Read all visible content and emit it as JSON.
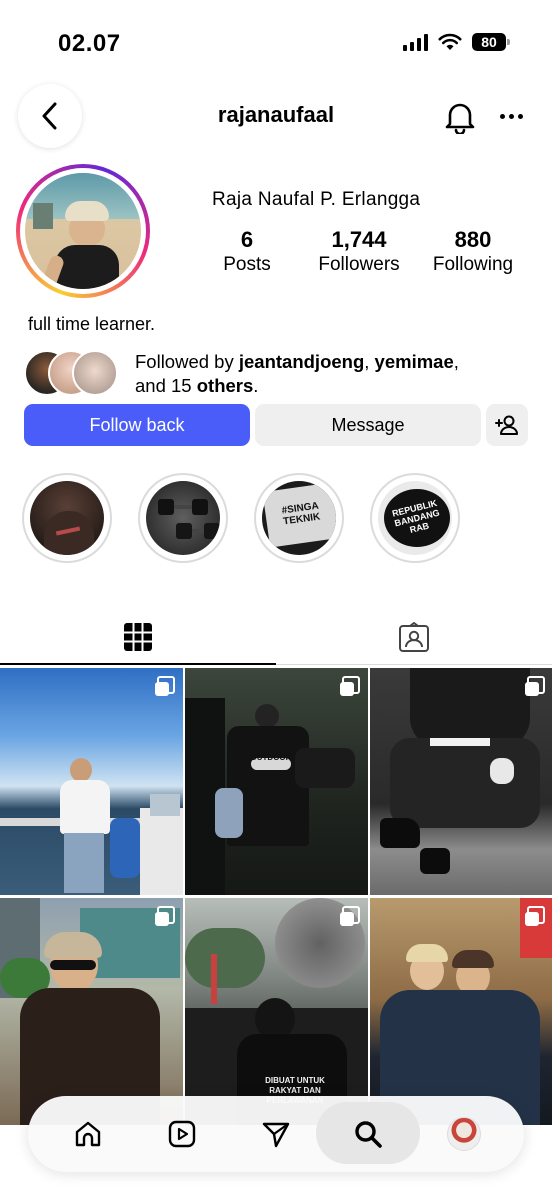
{
  "status_bar": {
    "time": "02.07",
    "battery": "80"
  },
  "header": {
    "username": "rajanaufaal"
  },
  "profile": {
    "full_name": "Raja Naufal P. Erlangga",
    "stats": [
      {
        "value": "6",
        "label": "Posts"
      },
      {
        "value": "1,744",
        "label": "Followers"
      },
      {
        "value": "880",
        "label": "Following"
      }
    ],
    "bio": "full time learner.",
    "followed_by": {
      "prefix": "Followed by ",
      "user1": "jeantandjoeng",
      "sep": ", ",
      "user2": "yemimae",
      "middle": ",",
      "and": "and 15 ",
      "others": "others",
      "end": "."
    }
  },
  "actions": {
    "follow_back": "Follow back",
    "message": "Message"
  },
  "highlights": [
    {
      "icon": "hoodie-photo"
    },
    {
      "icon": "dumbbell-photo"
    },
    {
      "icon": "shirt-print-photo",
      "text": "#SINGA TEKNIK"
    },
    {
      "icon": "sticker-photo",
      "text": "REPUBLIK BANDANG RAB"
    }
  ],
  "tabs": [
    {
      "icon": "grid-icon"
    },
    {
      "icon": "tagged-icon"
    }
  ],
  "posts": [
    {
      "type": "carousel",
      "scene": "boat-sea-sky"
    },
    {
      "type": "carousel",
      "scene": "crowd-outdoor-shirt",
      "text": "OUTDOOR"
    },
    {
      "type": "carousel",
      "scene": "bw-sitting-stairs"
    },
    {
      "type": "carousel",
      "scene": "street-sunglasses"
    },
    {
      "type": "carousel",
      "scene": "protest-smoke-banner",
      "text": "DIBUAT UNTUK RAKYAT DAN PERLAWANAN"
    },
    {
      "type": "carousel",
      "scene": "two-friends-couch"
    }
  ],
  "bottom_nav": [
    {
      "icon": "home-icon"
    },
    {
      "icon": "reels-icon"
    },
    {
      "icon": "send-icon"
    },
    {
      "icon": "search-icon",
      "active": true
    },
    {
      "icon": "profile-avatar-icon"
    }
  ],
  "colors": {
    "follow_button": "#4a5df9",
    "secondary_button": "#efefef",
    "divider": "#dbdbdb"
  }
}
